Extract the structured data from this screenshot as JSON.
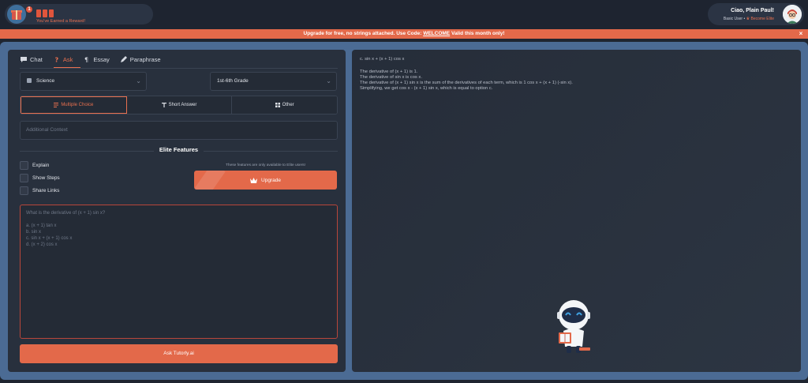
{
  "reward": {
    "badge_count": "1",
    "message": "You've Earned a Reward!"
  },
  "user": {
    "greeting": "Ciao, Plain Paul!",
    "plan": "Basic User",
    "separator": "•",
    "upgrade_link": "Become Elite"
  },
  "banner": {
    "text_before": "Upgrade for free, no strings attached. Use Code:",
    "code": "WELCOME",
    "text_after": "Valid this month only!",
    "close": "×"
  },
  "tabs": [
    {
      "label": "Chat",
      "icon": "chat-icon",
      "active": false
    },
    {
      "label": "Ask",
      "icon": "question-icon",
      "active": true
    },
    {
      "label": "Essay",
      "icon": "paragraph-icon",
      "active": false
    },
    {
      "label": "Paraphrase",
      "icon": "pen-icon",
      "active": false
    }
  ],
  "form": {
    "subject": "Science",
    "grade": "1st-6th Grade",
    "chevron": "⌄",
    "question_types": [
      {
        "label": "Multiple Choice",
        "active": true
      },
      {
        "label": "Short Answer",
        "active": false
      },
      {
        "label": "Other",
        "active": false
      }
    ],
    "context_placeholder": "Additional Context"
  },
  "elite": {
    "title": "Elite Features",
    "options": [
      "Explain",
      "Show Steps",
      "Share Links"
    ],
    "note": "These features are only available to Elite users!",
    "upgrade_label": "Upgrade"
  },
  "question": {
    "prompt": "What is the derivative of (x + 1) sin x?",
    "choices": [
      "a. (x + 1) tan x",
      "b. sin x",
      "c. sin x + (x + 1) cos x",
      "d. (x + 2) cos x"
    ]
  },
  "ask_button": "Ask Tutorly.ai",
  "answer": {
    "lead": "c. sin x + (x + 1) cos x",
    "lines": [
      "The derivative of (x + 1) is 1.",
      "The derivative of sin x is cos x.",
      "The derivative of (x + 1) sin x is the sum of the derivatives of each term, which is 1 cos x + (x + 1) (-sin x).",
      "Simplifying, we get cos x - (x + 1) sin x, which is equal to option c."
    ]
  },
  "colors": {
    "accent": "#e3694a",
    "frame": "#4b6b94",
    "panel": "#28303d"
  }
}
